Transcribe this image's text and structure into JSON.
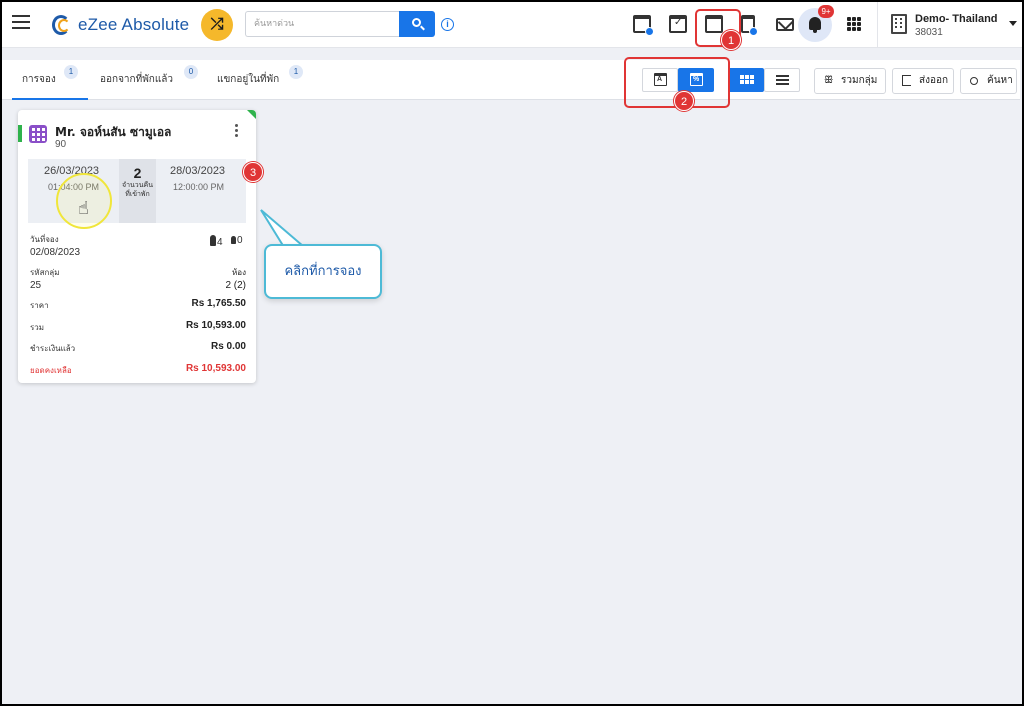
{
  "app": {
    "name": "eZee Absolute"
  },
  "search": {
    "placeholder": "ค้นหาด่วน"
  },
  "notifications": {
    "badge": "9+"
  },
  "property": {
    "name": "Demo- Thailand",
    "id": "38031"
  },
  "tabs": [
    {
      "label": "การจอง",
      "count": "1",
      "active": true
    },
    {
      "label": "ออกจากที่พักแล้ว",
      "count": "0",
      "active": false
    },
    {
      "label": "แขกอยู่ในที่พัก",
      "count": "1",
      "active": false
    }
  ],
  "actions": {
    "group": "รวมกลุ่ม",
    "export": "ส่งออก",
    "search": "ค้นหา"
  },
  "booking_card": {
    "guest_name": "Mr. จอห์นสัน ซามูเอล",
    "guest_sub": "90",
    "arrival_date": "26/03/2023",
    "arrival_time": "01:04:00 PM",
    "nights": "2",
    "nights_label": "จำนวนคืนที่เข้าพัก",
    "departure_date": "28/03/2023",
    "departure_time": "12:00:00 PM",
    "booking_date_label": "วันที่จอง",
    "booking_date": "02/08/2023",
    "adults": "4",
    "children": "0",
    "group_code_label": "รหัสกลุ่ม",
    "group_code": "25",
    "rooms_label": "ห้อง",
    "rooms": "2 (2)",
    "rate_label": "ราคา",
    "rate": "Rs 1,765.50",
    "total_label": "รวม",
    "total": "Rs 10,593.00",
    "paid_label": "ชำระเงินแล้ว",
    "paid": "Rs 0.00",
    "balance_label": "ยอดคงเหลือ",
    "balance": "Rs 10,593.00"
  },
  "annotations": {
    "step1": "1",
    "step2": "2",
    "step3": "3",
    "callout": "คลิกที่การจอง"
  },
  "colors": {
    "primary": "#1875e8",
    "highlight": "#e03535",
    "status_green": "#2fb24c",
    "shuffle_yellow": "#f5b82b"
  }
}
